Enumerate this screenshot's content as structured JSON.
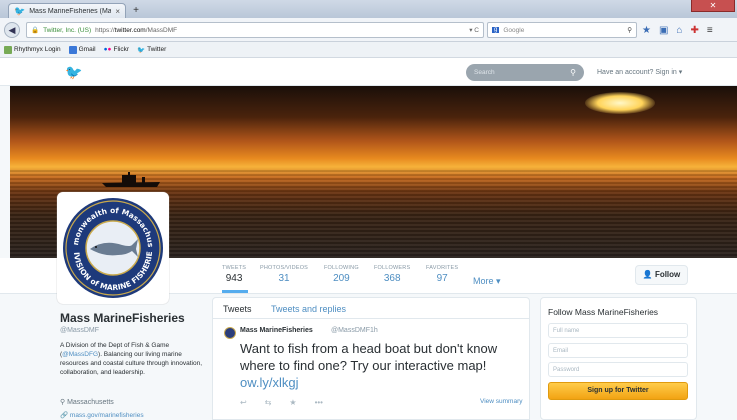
{
  "browser": {
    "tab_title": "Mass MarineFisheries (MassD...",
    "new_tab": "+",
    "url_identity": "Twitter, Inc. (US)",
    "url_scheme": "https://",
    "url_host": "twitter.com",
    "url_path": "/MassDMF",
    "search_engine": "Google",
    "bookmarks": [
      {
        "label": "Rhythmyx Login"
      },
      {
        "label": "Gmail"
      },
      {
        "label": "Flickr"
      },
      {
        "label": "Twitter"
      }
    ]
  },
  "twitter_header": {
    "search_placeholder": "Search",
    "signin_text": "Have an account? Sign in ▾"
  },
  "profile_nav": {
    "stats": [
      {
        "label": "TWEETS",
        "value": "943"
      },
      {
        "label": "PHOTOS/VIDEOS",
        "value": "31"
      },
      {
        "label": "FOLLOWING",
        "value": "209"
      },
      {
        "label": "FOLLOWERS",
        "value": "368"
      },
      {
        "label": "FAVORITES",
        "value": "97"
      }
    ],
    "more": "More ▾",
    "follow_label": "Follow"
  },
  "seal": {
    "top_text": "Commonwealth of Massachusetts",
    "bottom_text": "DIVISION of MARINE FISHERIES"
  },
  "profile": {
    "name": "Mass MarineFisheries",
    "handle": "@MassDMF",
    "bio_part1": "A Division of the Dept of Fish & Game (",
    "bio_link": "@MassDFG",
    "bio_part2": "). Balancing our living marine resources and coastal culture through innovation, collaboration, and leadership.",
    "location": "Massachusetts",
    "website": "mass.gov/marinefisheries"
  },
  "timeline": {
    "tabs": [
      "Tweets",
      "Tweets and replies"
    ],
    "tweet": {
      "author": "Mass MarineFisheries",
      "handle": "@MassDMF",
      "time": "1h",
      "text": "Want to fish from a head boat but don't know where to find one? Try our interactive map!",
      "link": "ow.ly/xlkgj",
      "view_summary": "View summary"
    }
  },
  "signup": {
    "title": "Follow Mass MarineFisheries",
    "full_name_placeholder": "Full name",
    "email_placeholder": "Email",
    "password_placeholder": "Password",
    "button": "Sign up for Twitter"
  },
  "colors": {
    "twitter_blue": "#55acee",
    "link_blue": "#4e8ec2",
    "signup_button": "#f2a313"
  }
}
